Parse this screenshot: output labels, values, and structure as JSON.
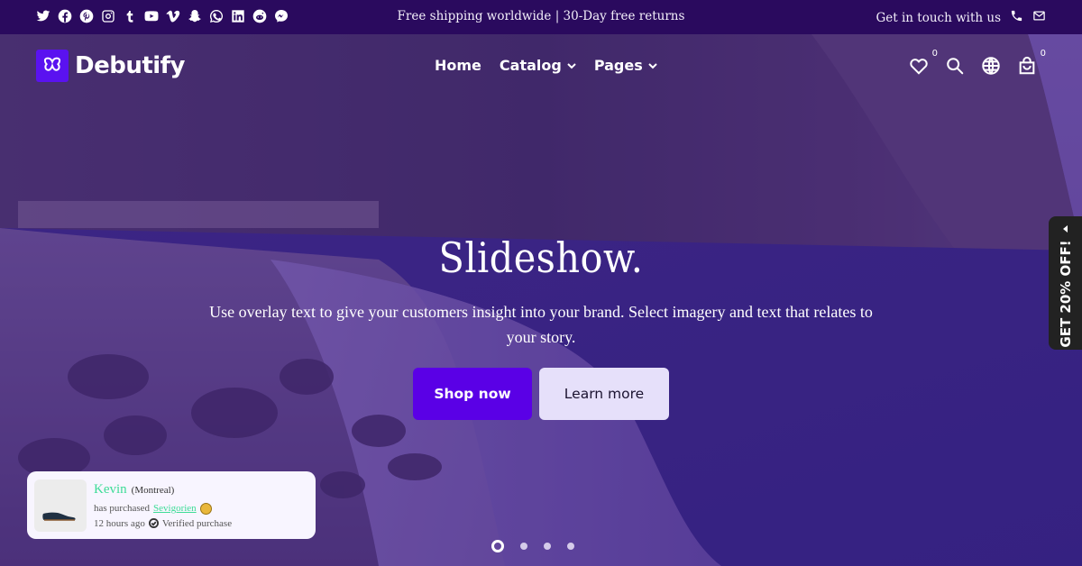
{
  "topbar": {
    "social_icons": [
      "twitter-icon",
      "facebook-icon",
      "pinterest-icon",
      "instagram-icon",
      "tumblr-icon",
      "youtube-icon",
      "vimeo-icon",
      "snapchat-icon",
      "whatsapp-icon",
      "linkedin-icon",
      "reddit-icon",
      "messenger-icon"
    ],
    "announcement": "Free shipping worldwide | 30-Day free returns",
    "contact_label": "Get in touch with us",
    "contact_icons": [
      "phone-icon",
      "mail-icon"
    ]
  },
  "header": {
    "logo_text": "Debutify",
    "nav": [
      {
        "label": "Home",
        "has_dropdown": false
      },
      {
        "label": "Catalog",
        "has_dropdown": true
      },
      {
        "label": "Pages",
        "has_dropdown": true
      }
    ],
    "wishlist_count": "0",
    "cart_count": "0"
  },
  "hero": {
    "title": "Slideshow.",
    "subtitle": "Use overlay text to give your customers insight into your brand. Select imagery and text that relates to your story.",
    "primary_button": "Shop now",
    "secondary_button": "Learn more",
    "slides_total": 4,
    "active_slide": 1
  },
  "side_tab": {
    "label": "GET 20% OFF!"
  },
  "purchase_popup": {
    "name": "Kevin",
    "city": "(Montreal)",
    "action": "has purchased",
    "product": "Sevigorien",
    "time": "12 hours ago",
    "verified": "Verified purchase"
  },
  "colors": {
    "topbar_bg": "#2a0a5e",
    "brand_primary": "#5a00e6",
    "secondary_button_bg": "#e6e0fa",
    "popup_accent": "#3ddc97",
    "side_tab_bg": "#222222"
  }
}
